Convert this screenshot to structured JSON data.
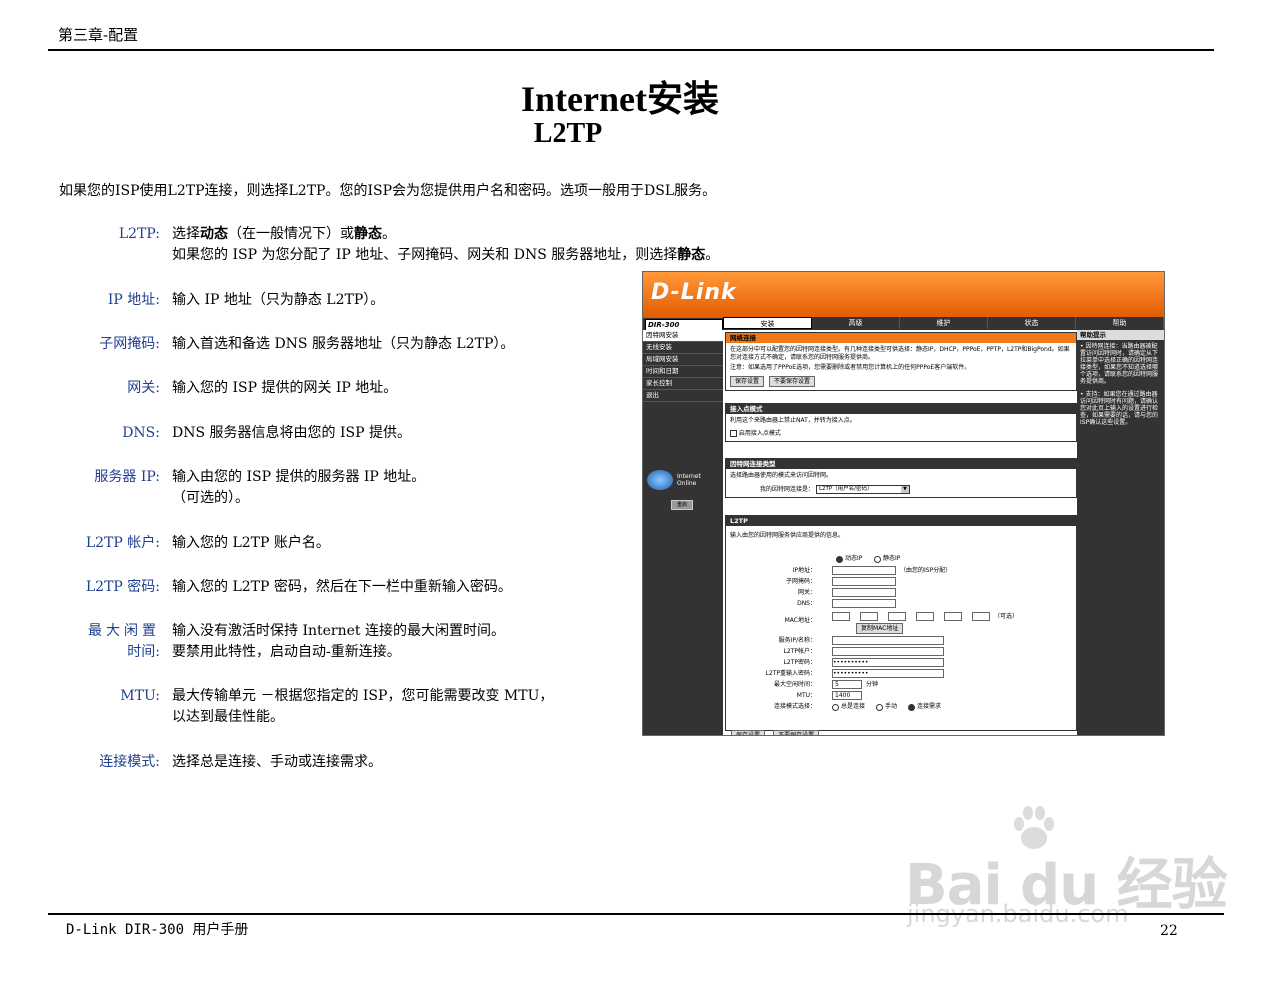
{
  "header": {
    "chapter": "第三章-配置"
  },
  "title": {
    "main": "Internet安装",
    "sub": "L2TP"
  },
  "intro": "如果您的ISP使用L2TP连接，则选择L2TP。您的ISP会为您提供用户名和密码。选项一般用于DSL服务。",
  "definitions": [
    {
      "term": "L2TP:",
      "lines": [
        "选择动态（在一般情况下）或静态。",
        "如果您的 ISP 为您分配了 IP 地址、子网掩码、网关和 DNS 服务器地址，则选择静态。"
      ]
    },
    {
      "term": "IP 地址:",
      "lines": [
        "输入 IP 地址（只为静态 L2TP）。"
      ]
    },
    {
      "term": "子网掩码:",
      "lines": [
        "输入首选和备选 DNS 服务器地址（只为静态 L2TP）。"
      ]
    },
    {
      "term": "网关:",
      "lines": [
        "输入您的 ISP 提供的网关 IP 地址。"
      ]
    },
    {
      "term": "DNS:",
      "lines": [
        "DNS 服务器信息将由您的 ISP 提供。"
      ]
    },
    {
      "term": "服务器 IP:",
      "lines": [
        "输入由您的 ISP 提供的服务器 IP 地址。",
        "（可选的）。"
      ]
    },
    {
      "term": "L2TP 帐户:",
      "lines": [
        "输入您的 L2TP 账户名。"
      ]
    },
    {
      "term": "L2TP 密码:",
      "lines": [
        "输入您的 L2TP 密码，然后在下一栏中重新输入密码。"
      ]
    },
    {
      "term": "最大闲置",
      "term2": "时间:",
      "lines": [
        "输入没有激活时保持 Internet 连接的最大闲置时间。",
        "要禁用此特性，启动自动-重新连接。"
      ]
    },
    {
      "term": "MTU:",
      "lines": [
        "最大传输单元 －根据您指定的 ISP，您可能需要改变 MTU，",
        "以达到最佳性能。"
      ]
    },
    {
      "term": "连接模式:",
      "lines": [
        "选择总是连接、手动或连接需求。"
      ]
    }
  ],
  "footer": {
    "left": "D-Link DIR-300 用户手册",
    "page": "22"
  },
  "screenshot": {
    "logo": "D-Link",
    "model": "DIR-300",
    "tabs": [
      "安装",
      "高级",
      "维护",
      "状态",
      "帮助"
    ],
    "nav": [
      "因特网安装",
      "无线安装",
      "局域网安装",
      "时间和日期",
      "家长控制",
      "退出"
    ],
    "online": "Internet Online",
    "reboot": "重启",
    "net_title": "网络连接",
    "net_text": "在这部分中可以配置您的因特网连接类型。有几种连接类型可供选择：静态IP，DHCP，PPPoE，PPTP，L2TP和BigPond。如果您对连接方式不确定，请联系您的因特网服务提供商。",
    "net_note": "注意：如果选用了PPPoE选项，您需要删除或者禁用您计算机上的任何PPPoE客户端软件。",
    "save": "保存设置",
    "nosave": "不要保存设置",
    "access_title": "接入点模式",
    "access_text": "利用这个来路由器上禁止NAT，并转为接入点。",
    "access_cb": "启用接入点模式",
    "type_title": "因特网连接类型",
    "type_text": "选择路由器使用的模式来访问因特网。",
    "type_label": "我的因特网连接是：",
    "type_value": "L2TP（用户名/密码）",
    "l2tp_title": "L2TP",
    "l2tp_text": "输入由您的因特网服务供应商提供的信息。",
    "radio_dynamic": "动态IP",
    "radio_static": "静态IP",
    "fields": [
      "IP地址：",
      "子网掩码：",
      "网关：",
      "DNS：",
      "MAC地址：",
      "服务IP/名称：",
      "L2TP帐户：",
      "L2TP密码：",
      "L2TP重输入密码：",
      "最大空闲时间：",
      "MTU："
    ],
    "isp_note": "（由您的ISP分配）",
    "mac_note": "（可选）",
    "clone_mac": "复制MAC地址",
    "password_mask": "••••••••••",
    "idle_value": "5",
    "idle_unit": "分钟",
    "mtu_value": "1400",
    "conn_label": "连接模式选择：",
    "conn_opts": [
      "总是连接",
      "手动",
      "连接需求"
    ],
    "help_title": "帮助提示",
    "help_items": [
      "• 因特网连接：当路由器被配置访问因特网时，请确定从下拉菜单中选择正确的因特网连接类型，如果您不知道选择哪个选项，请联系您的因特网服务提供商。",
      "• 支持：如果您在通过路由器访问因特网时有问题，请确认您对此页上输入的设置进行检查，如果需要的话，请与您的ISP确认这些设置。"
    ]
  },
  "watermark": {
    "brand": "Bai du 经验",
    "url": "jingyan.baidu.com"
  }
}
